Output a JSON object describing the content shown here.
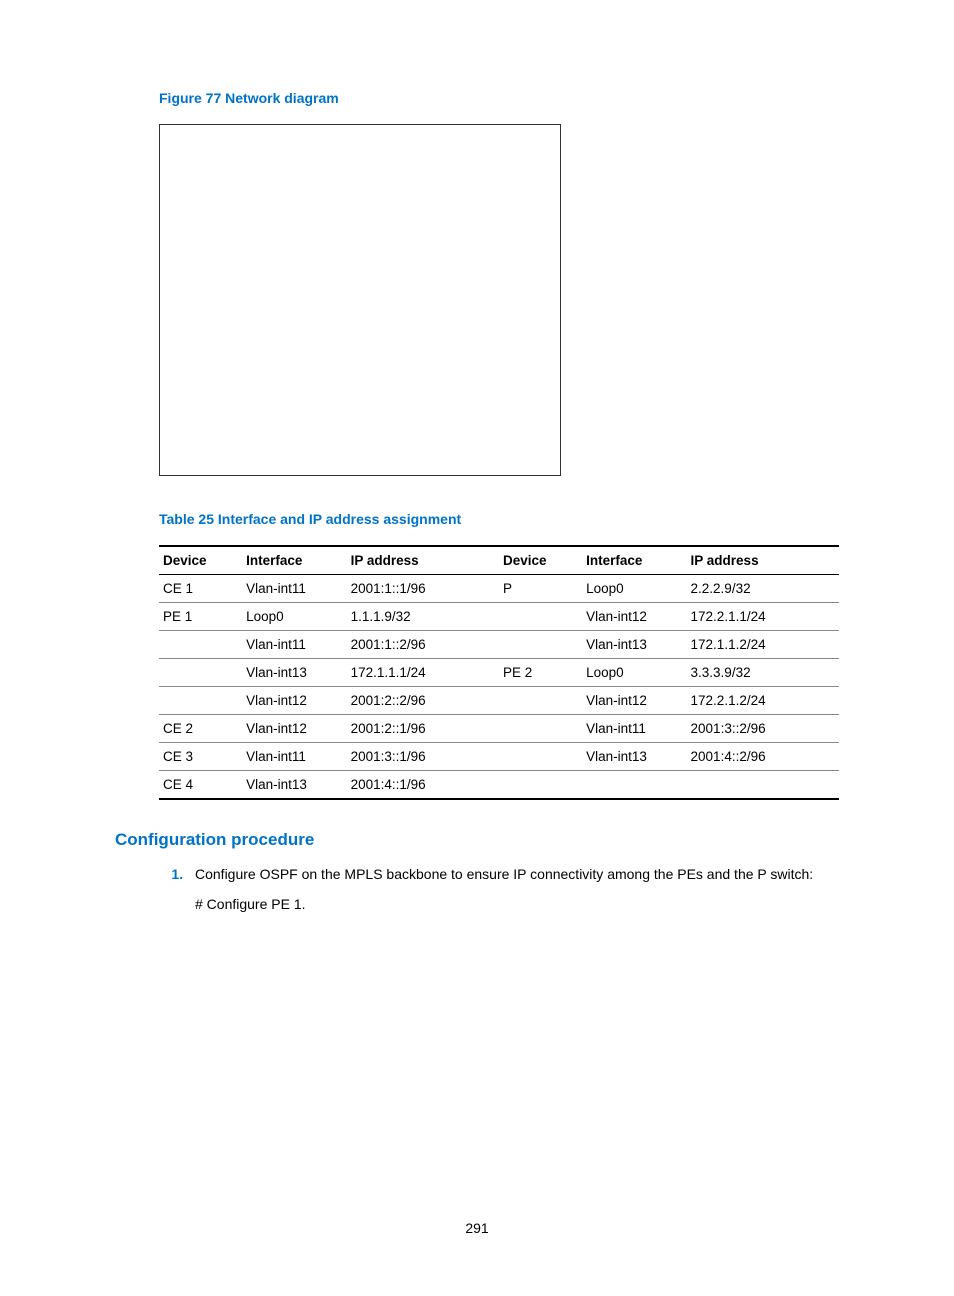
{
  "figure": {
    "caption": "Figure 77 Network diagram"
  },
  "table": {
    "caption": "Table 25 Interface and IP address assignment",
    "headers": {
      "device1": "Device",
      "intf1": "Interface",
      "ip1": "IP address",
      "device2": "Device",
      "intf2": "Interface",
      "ip2": "IP address"
    },
    "rows": [
      {
        "d1": "CE 1",
        "i1": "Vlan-int11",
        "a1": "2001:1::1/96",
        "d2": "P",
        "i2": "Loop0",
        "a2": "2.2.2.9/32"
      },
      {
        "d1": "PE 1",
        "i1": "Loop0",
        "a1": "1.1.1.9/32",
        "d2": "",
        "i2": "Vlan-int12",
        "a2": "172.2.1.1/24"
      },
      {
        "d1": "",
        "i1": "Vlan-int11",
        "a1": "2001:1::2/96",
        "d2": "",
        "i2": "Vlan-int13",
        "a2": "172.1.1.2/24"
      },
      {
        "d1": "",
        "i1": "Vlan-int13",
        "a1": "172.1.1.1/24",
        "d2": "PE 2",
        "i2": "Loop0",
        "a2": "3.3.3.9/32"
      },
      {
        "d1": "",
        "i1": "Vlan-int12",
        "a1": "2001:2::2/96",
        "d2": "",
        "i2": "Vlan-int12",
        "a2": "172.2.1.2/24"
      },
      {
        "d1": "CE 2",
        "i1": "Vlan-int12",
        "a1": "2001:2::1/96",
        "d2": "",
        "i2": "Vlan-int11",
        "a2": "2001:3::2/96"
      },
      {
        "d1": "CE 3",
        "i1": "Vlan-int11",
        "a1": "2001:3::1/96",
        "d2": "",
        "i2": "Vlan-int13",
        "a2": "2001:4::2/96"
      },
      {
        "d1": "CE 4",
        "i1": "Vlan-int13",
        "a1": "2001:4::1/96",
        "d2": "",
        "i2": "",
        "a2": ""
      }
    ]
  },
  "section": {
    "heading": "Configuration procedure",
    "steps": [
      {
        "text": "Configure OSPF on the MPLS backbone to ensure IP connectivity among the PEs and the P switch:",
        "sub": "# Configure PE 1."
      }
    ]
  },
  "page_number": "291"
}
